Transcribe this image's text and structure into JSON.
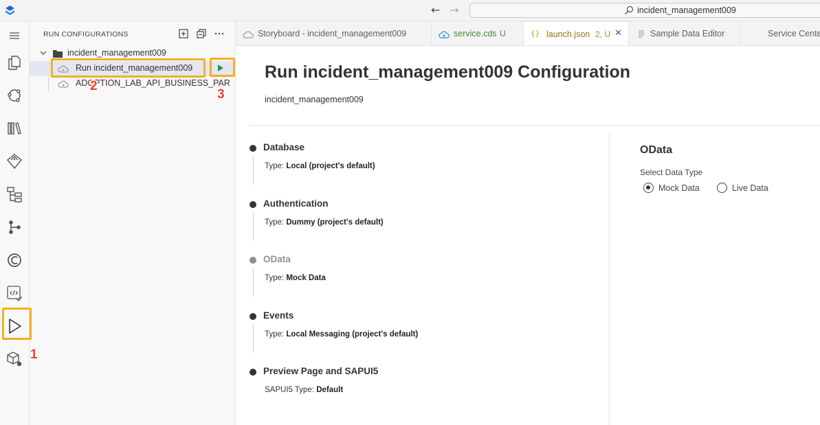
{
  "titlebar": {
    "search_text": "incident_management009"
  },
  "activity_bar": {
    "icons": [
      "menu-icon",
      "explorer-icon",
      "source-map-icon",
      "library-icon",
      "gem-icon",
      "hierarchy-icon",
      "source-control-icon",
      "cloud-ring-icon",
      "code-check-icon",
      "run-icon",
      "extensions-icon"
    ]
  },
  "sidebar": {
    "title": "RUN CONFIGURATIONS",
    "root_label": "incident_management009",
    "items": [
      {
        "label": "Run incident_management009",
        "selected": true
      },
      {
        "label": "ADOPTION_LAB_API_BUSINESS_PAR",
        "selected": false
      }
    ]
  },
  "annotations": {
    "badge_1": "1",
    "badge_2": "2",
    "badge_3": "3",
    "highlight_color": "#f2b120",
    "badge_color": "#e8412c"
  },
  "tabs": [
    {
      "label": "Storyboard - incident_management009",
      "modified": "",
      "active": false
    },
    {
      "label": "service.cds",
      "modified": "U",
      "active": false
    },
    {
      "label": "launch.json",
      "modified": "2, U",
      "active": true
    },
    {
      "label": "Sample Data Editor",
      "modified": "",
      "active": false
    },
    {
      "label": "Service Center",
      "modified": "",
      "active": false
    }
  ],
  "editor": {
    "title": "Run incident_management009 Configuration",
    "subtitle": "incident_management009",
    "steps": [
      {
        "title": "Database",
        "type_label": "Type:",
        "type_value": "Local (project's default)"
      },
      {
        "title": "Authentication",
        "type_label": "Type:",
        "type_value": "Dummy (project's default)"
      },
      {
        "title": "OData",
        "type_label": "Type:",
        "type_value": "Mock Data"
      },
      {
        "title": "Events",
        "type_label": "Type:",
        "type_value": "Local Messaging (project's default)"
      },
      {
        "title": "Preview Page and SAPUI5",
        "type_label": "SAPUI5 Type:",
        "type_value": "Default"
      }
    ],
    "odata_panel": {
      "title": "OData",
      "label": "Select Data Type",
      "options": [
        {
          "label": "Mock Data",
          "selected": true
        },
        {
          "label": "Live Data",
          "selected": false
        }
      ]
    }
  }
}
